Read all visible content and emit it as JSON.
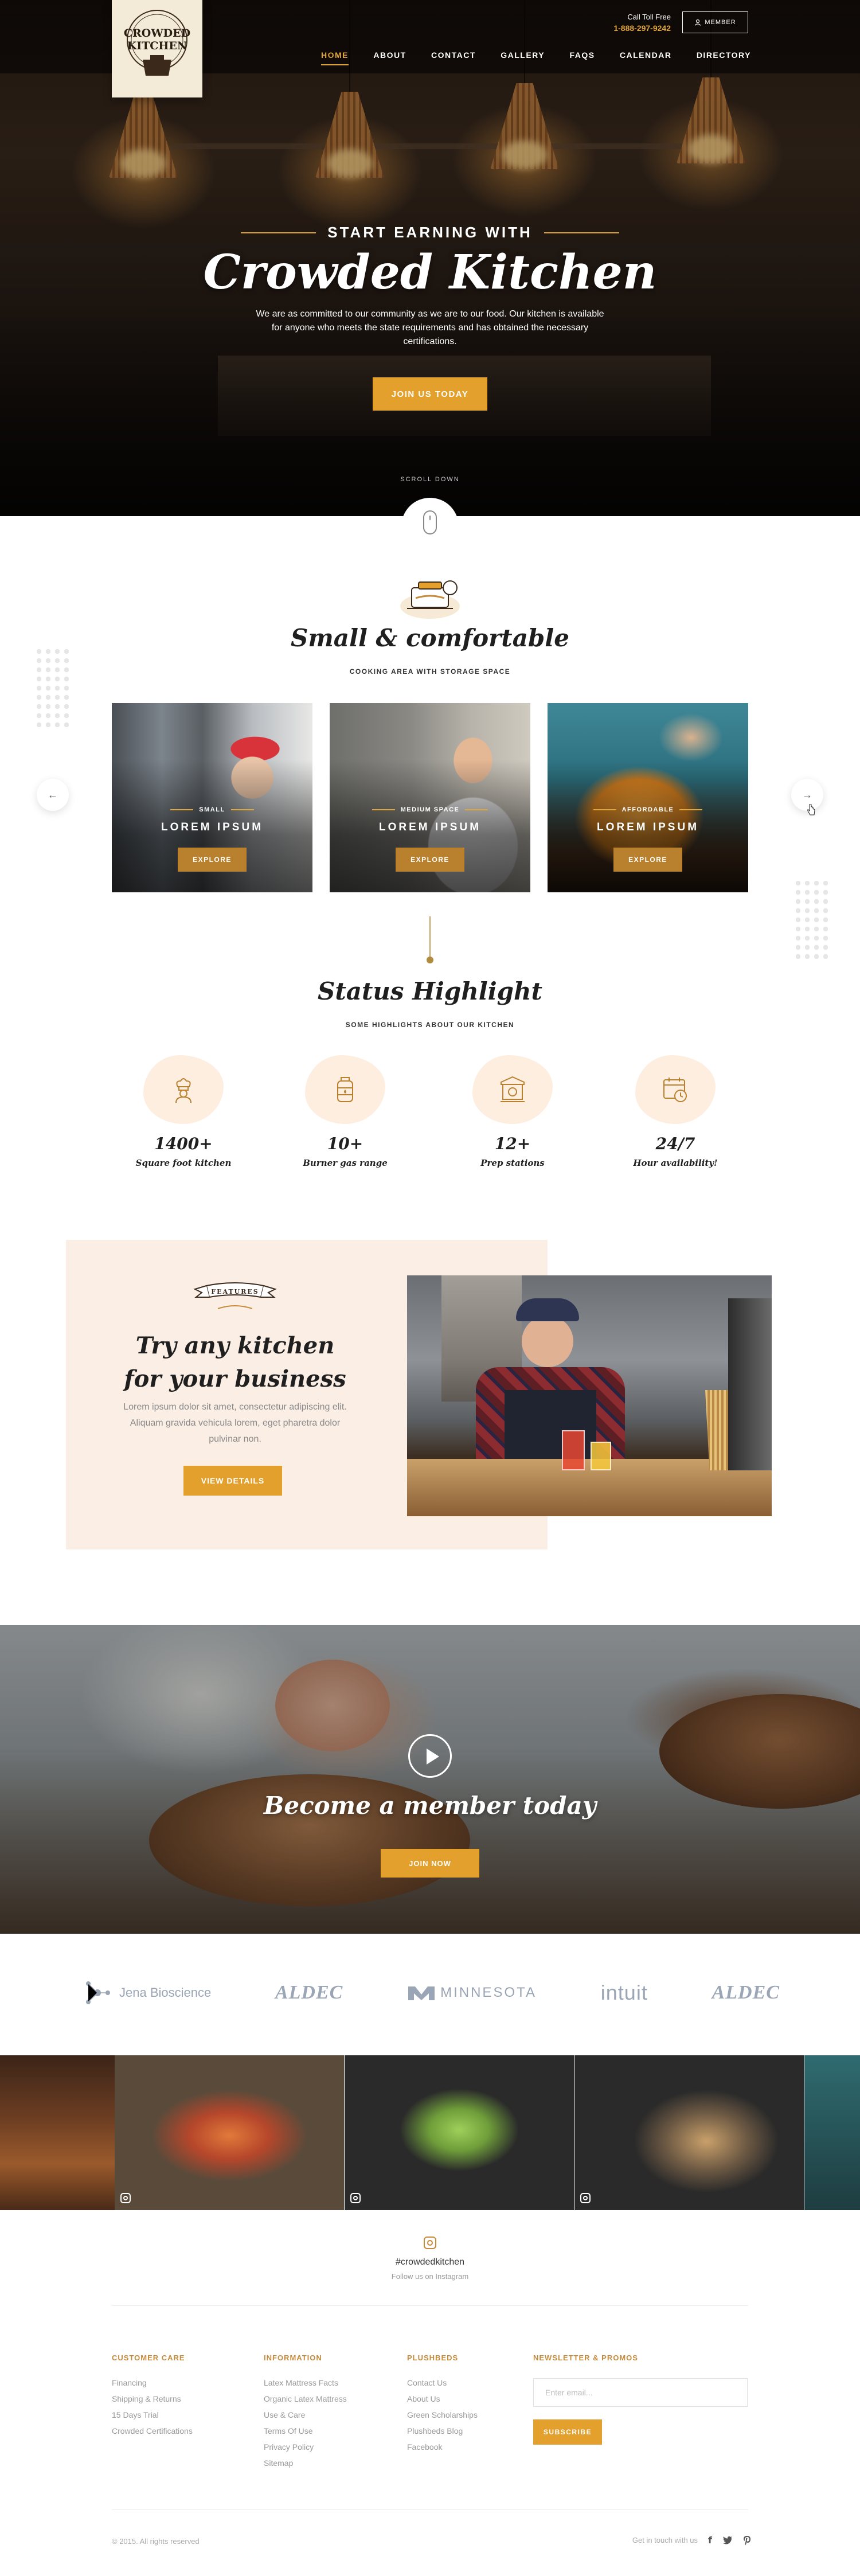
{
  "header": {
    "logo_alt": "Crowded Kitchen",
    "logo_line1": "CROWDED",
    "logo_line2": "KITCHEN",
    "call_label": "Call Toll Free",
    "call_number": "1-888-297-9242",
    "member_label": "MEMBER",
    "nav": [
      {
        "label": "HOME",
        "active": true
      },
      {
        "label": "ABOUT"
      },
      {
        "label": "CONTACT"
      },
      {
        "label": "GALLERY"
      },
      {
        "label": "FAQS"
      },
      {
        "label": "CALENDAR"
      },
      {
        "label": "DIRECTORY"
      }
    ]
  },
  "hero": {
    "kicker": "START EARNING WITH",
    "title": "Crowded Kitchen",
    "text": "We are as committed to our community as we are to our food. Our kitchen is available for anyone who meets the state requirements and has obtained the necessary certifications.",
    "cta": "JOIN US TODAY",
    "scroll_label": "SCROLL DOWN"
  },
  "spaces": {
    "title": "Small & comfortable",
    "subtitle": "COOKING AREA WITH STORAGE SPACE",
    "cards": [
      {
        "tag": "SMALL",
        "title": "LOREM IPSUM",
        "button": "EXPLORE"
      },
      {
        "tag": "MEDIUM SPACE",
        "title": "LOREM IPSUM",
        "button": "EXPLORE"
      },
      {
        "tag": "AFFORDABLE",
        "title": "LOREM IPSUM",
        "button": "EXPLORE"
      }
    ],
    "prev_icon": "arrow-left-icon",
    "next_icon": "arrow-right-icon"
  },
  "status": {
    "title": "Status Highlight",
    "subtitle": "SOME HIGHLIGHTS ABOUT OUR KITCHEN",
    "items": [
      {
        "value": "1400+",
        "label": "Square foot kitchen",
        "icon": "chef-icon"
      },
      {
        "value": "10+",
        "label": "Burner gas range",
        "icon": "gas-tank-icon"
      },
      {
        "value": "12+",
        "label": "Prep stations",
        "icon": "prep-station-icon"
      },
      {
        "value": "24/7",
        "label": "Hour availability!",
        "icon": "calendar-clock-icon"
      }
    ]
  },
  "feature": {
    "ribbon": "FEATURES",
    "title": "Try any kitchen for your business",
    "text": "Lorem ipsum dolor sit amet, consectetur adipiscing elit. Aliquam gravida vehicula lorem, eget pharetra dolor pulvinar non.",
    "cta": "VIEW DETAILS"
  },
  "member": {
    "title": "Become a member today",
    "cta": "JOIN NOW"
  },
  "partners": [
    "Jena Bioscience",
    "ALDEC",
    "MINNESOTA",
    "intuit",
    "ALDEC"
  ],
  "instagram": {
    "handle": "#crowdedkitchen",
    "follow": "Follow us on Instagram"
  },
  "footer": {
    "columns": [
      {
        "heading": "CUSTOMER CARE",
        "links": [
          "Financing",
          "Shipping & Returns",
          "15 Days Trial",
          "Crowded Certifications"
        ]
      },
      {
        "heading": "INFORMATION",
        "links": [
          "Latex Mattress Facts",
          "Organic Latex Mattress",
          "Use & Care",
          "Terms Of Use",
          "Privacy Policy",
          "Sitemap"
        ]
      },
      {
        "heading": "PLUSHBEDS",
        "links": [
          "Contact Us",
          "About Us",
          "Green Scholarships",
          "Plushbeds Blog",
          "Facebook"
        ]
      }
    ],
    "newsletter": {
      "heading": "NEWSLETTER & PROMOS",
      "placeholder": "Enter email...",
      "button": "SUBSCRIBE"
    },
    "copyright": "© 2015. All rights reserved",
    "social_label": "Get in touch with us",
    "social_icons": [
      "facebook-icon",
      "twitter-icon",
      "pinterest-icon"
    ]
  },
  "colors": {
    "accent": "#e3a02c",
    "accent_dark": "#b9802e",
    "panel": "#fbeee5",
    "stat_blob": "#fdeee0"
  }
}
